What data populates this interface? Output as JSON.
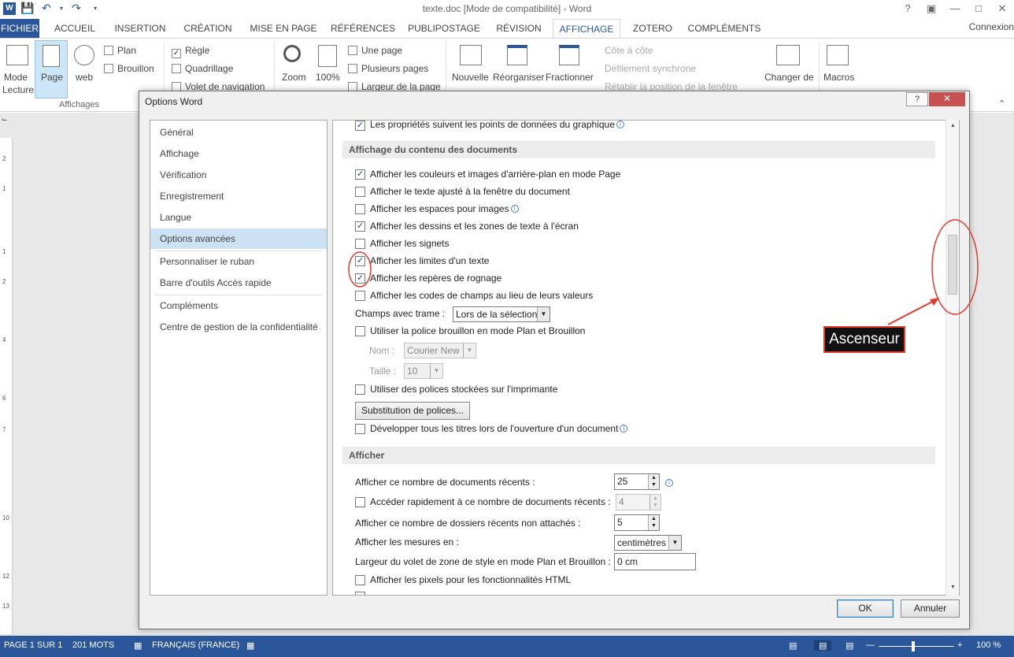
{
  "window": {
    "title": "texte.doc [Mode de compatibilité] - Word",
    "signin": "Connexion",
    "app_icon": "W"
  },
  "ribbon_tabs": [
    "FICHIER",
    "ACCUEIL",
    "INSERTION",
    "CRÉATION",
    "MISE EN PAGE",
    "RÉFÉRENCES",
    "PUBLIPOSTAGE",
    "RÉVISION",
    "AFFICHAGE",
    "ZOTERO",
    "COMPLÉMENTS"
  ],
  "ribbon": {
    "mode_lecture": [
      "Mode",
      "Lecture"
    ],
    "page": "Page",
    "web": "web",
    "plan": "Plan",
    "brouillon": "Brouillon",
    "group_affichages": "Affichages",
    "regle": "Règle",
    "quadrillage": "Quadrillage",
    "volet": "Volet de navigation",
    "zoom": "Zoom",
    "zoom100": "100%",
    "une_page": "Une page",
    "plusieurs_pages": "Plusieurs pages",
    "largeur_page": "Largeur de la page",
    "nouvelle_fenetre": "Nouvelle",
    "reorganiser": "Réorganiser",
    "fractionner": "Fractionner",
    "cote_a_cote": "Côte à côte",
    "defilement": "Défilement synchrone",
    "retablir": "Rétablir la position de la fenêtre",
    "changer": "Changer de",
    "macros": "Macros"
  },
  "dialog": {
    "title": "Options Word",
    "help": "?",
    "close": "✕",
    "nav": [
      "Général",
      "Affichage",
      "Vérification",
      "Enregistrement",
      "Langue",
      "Options avancées",
      "Personnaliser le ruban",
      "Barre d'outils Accès rapide",
      "Compléments",
      "Centre de gestion de la confidentialité"
    ],
    "top_partial": "Les propriétés suivent les points de données du graphique",
    "section1": "Affichage du contenu des documents",
    "opts1": [
      {
        "label": "Afficher les couleurs et images d'arrière-plan en mode Page",
        "checked": true
      },
      {
        "label": "Afficher le texte ajusté à la fenêtre du document",
        "checked": false
      },
      {
        "label": "Afficher les espaces pour images",
        "checked": false
      },
      {
        "label": "Afficher les dessins et les zones de texte à l'écran",
        "checked": true
      },
      {
        "label": "Afficher les signets",
        "checked": false
      },
      {
        "label": "Afficher les limites d'un texte",
        "checked": true
      },
      {
        "label": "Afficher les repères de rognage",
        "checked": true
      },
      {
        "label": "Afficher les codes de champs au lieu de leurs valeurs",
        "checked": false
      }
    ],
    "champs_label": "Champs avec trame :",
    "champs_value": "Lors de la sélection",
    "police_brouillon": "Utiliser la police brouillon en mode Plan et Brouillon",
    "nom_label": "Nom :",
    "nom_value": "Courier New",
    "taille_label": "Taille :",
    "taille_value": "10",
    "polices_imprimante": "Utiliser des polices stockées sur l'imprimante",
    "substitution_btn": "Substitution de polices...",
    "developper": "Développer tous les titres lors de l'ouverture d'un document",
    "section2": "Afficher",
    "docs_recents_label": "Afficher ce nombre de documents récents :",
    "docs_recents_value": "25",
    "acceder_label": "Accéder rapidement à ce nombre de documents récents :",
    "acceder_value": "4",
    "dossiers_label": "Afficher ce nombre de dossiers récents non attachés :",
    "dossiers_value": "5",
    "mesures_label": "Afficher les mesures en :",
    "mesures_value": "centimètres",
    "largeur_volet_label": "Largeur du volet de zone de style en mode Plan et Brouillon :",
    "largeur_volet_value": "0 cm",
    "pixels_label": "Afficher les pixels pour les fonctionnalités HTML",
    "ok": "OK",
    "annuler": "Annuler"
  },
  "annotation": {
    "label": "Ascenseur",
    "color": "#e23b2c"
  },
  "status": {
    "page": "PAGE 1 SUR 1",
    "mots": "201 MOTS",
    "langue": "FRANÇAIS (FRANCE)",
    "zoom": "100 %"
  },
  "colors": {
    "accent": "#2b579a",
    "selection": "#cce1f4"
  }
}
